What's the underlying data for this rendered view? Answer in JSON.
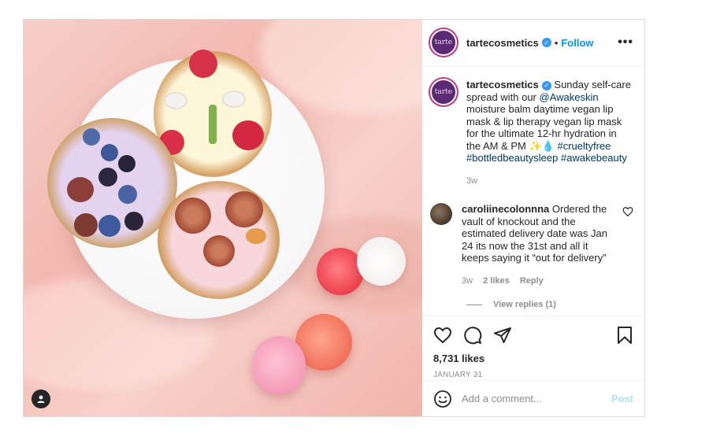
{
  "post": {
    "username": "tartecosmetics",
    "logo_text": "tarte",
    "follow_label": "Follow",
    "more_label": "•••",
    "caption": {
      "username": "tartecosmetics",
      "text_1": "Sunday self-care spread with our ",
      "mention": "@Awakeskin",
      "text_2": " moisture balm daytime vegan lip mask & lip therapy vegan lip mask for the ultimate 12-hr hydration in the AM & PM ✨💧 ",
      "hashtag_1": "#crueltyfree",
      "hashtag_2": "#bottledbeautysleep",
      "hashtag_3": "#awakebeauty",
      "time": "3w"
    },
    "comment": {
      "username": "caroliinecolonnna",
      "text": "Ordered the vault of knockout and the estimated delivery date was Jan 24 its now the 31st and all it keeps saying it “out for delivery”",
      "time": "3w",
      "likes": "2 likes",
      "reply_label": "Reply",
      "view_replies": "View replies (1)"
    },
    "likes_count": "8,731 likes",
    "date": "JANUARY 31",
    "add_comment_placeholder": "Add a comment...",
    "post_button": "Post"
  },
  "colors": {
    "accent": "#0095f6",
    "verified": "#3897f0",
    "brand_purple": "#5a2a74"
  }
}
